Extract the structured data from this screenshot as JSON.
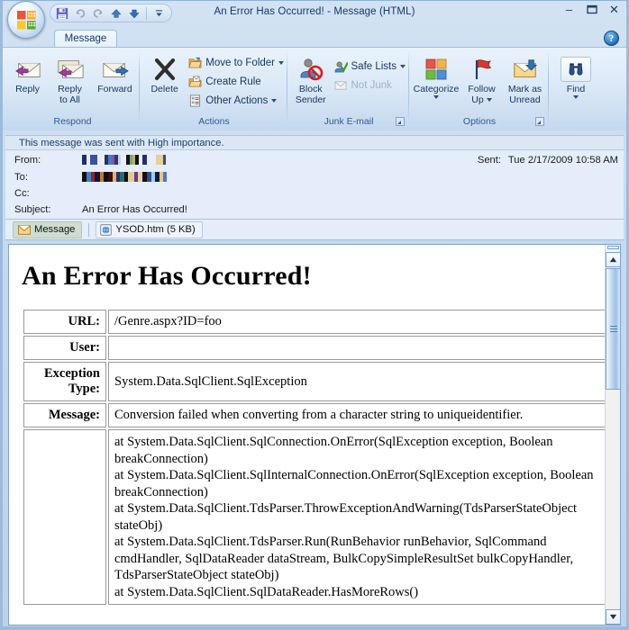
{
  "window": {
    "title": "An Error Has Occurred!  - Message (HTML)",
    "office_button": "office-orb",
    "controls": {
      "minimize": "–",
      "maximize": "❑",
      "close": "✕"
    },
    "help": "?"
  },
  "quick_access": {
    "items": [
      {
        "name": "save-button",
        "glyph": "save-icon"
      },
      {
        "name": "undo-button",
        "glyph": "undo-icon"
      },
      {
        "name": "redo-button",
        "glyph": "redo-icon"
      },
      {
        "name": "previous-item-button",
        "glyph": "up-arrow-icon"
      },
      {
        "name": "next-item-button",
        "glyph": "down-arrow-icon"
      }
    ],
    "customize_label": "customize-qat-icon"
  },
  "tabs": [
    {
      "label": "Message",
      "active": true
    }
  ],
  "ribbon": {
    "groups": [
      {
        "id": "respond",
        "label": "Respond",
        "buttons": [
          {
            "label": "Reply",
            "icon": "reply-icon"
          },
          {
            "label": "Reply\nto All",
            "line1": "Reply",
            "line2": "to All",
            "icon": "reply-all-icon"
          },
          {
            "label": "Forward",
            "icon": "forward-icon"
          }
        ]
      },
      {
        "id": "actions",
        "label": "Actions",
        "big": [
          {
            "label": "Delete",
            "icon": "delete-x-icon"
          }
        ],
        "small": [
          {
            "label": "Move to Folder",
            "icon": "move-to-folder-icon",
            "dropdown": true
          },
          {
            "label": "Create Rule",
            "icon": "create-rule-icon",
            "dropdown": false
          },
          {
            "label": "Other Actions",
            "icon": "other-actions-icon",
            "dropdown": true
          }
        ]
      },
      {
        "id": "junk",
        "label": "Junk E-mail",
        "big": [
          {
            "line1": "Block",
            "line2": "Sender",
            "icon": "block-sender-icon"
          }
        ],
        "small": [
          {
            "label": "Safe Lists",
            "icon": "safe-lists-icon",
            "dropdown": true
          },
          {
            "label": "Not Junk",
            "icon": "not-junk-icon",
            "dropdown": false,
            "disabled": true
          }
        ],
        "has_launcher": true
      },
      {
        "id": "options",
        "label": "Options",
        "buttons": [
          {
            "label": "Categorize",
            "icon": "categorize-icon",
            "dropdown": true
          },
          {
            "line1": "Follow",
            "line2": "Up",
            "icon": "follow-up-flag-icon",
            "dropdown": true
          },
          {
            "line1": "Mark as",
            "line2": "Unread",
            "icon": "mark-unread-icon",
            "dropdown": false
          }
        ],
        "has_launcher": true
      },
      {
        "id": "find",
        "label": "",
        "buttons": [
          {
            "label": "Find",
            "icon": "binoculars-icon",
            "dropdown": true
          }
        ]
      }
    ]
  },
  "infobar": {
    "text": "This message was sent with High importance."
  },
  "headers": {
    "from_label": "From:",
    "to_label": "To:",
    "cc_label": "Cc:",
    "subject_label": "Subject:",
    "sent_label": "Sent:",
    "sent_value": "Tue 2/17/2009 10:58 AM",
    "from_value": "",
    "to_value": "",
    "cc_value": "",
    "subject_value": "An Error Has Occurred!",
    "from_redacted_blocks": [
      {
        "w": 5,
        "c": "#1a2f6e"
      },
      {
        "w": 4,
        "c": "#e8eefb"
      },
      {
        "w": 8,
        "c": "#3b4fa3"
      },
      {
        "w": 8,
        "c": "#e8eefb"
      },
      {
        "w": 4,
        "c": "#2a2f5e"
      },
      {
        "w": 4,
        "c": "#4a78c8"
      },
      {
        "w": 3,
        "c": "#7b5aa8"
      },
      {
        "w": 4,
        "c": "#2f3670"
      },
      {
        "w": 3,
        "c": "#c6d2e8"
      },
      {
        "w": 6,
        "c": "#e8eefb"
      },
      {
        "w": 4,
        "c": "#141414"
      },
      {
        "w": 3,
        "c": "#7aa86a"
      },
      {
        "w": 3,
        "c": "#b9b07a"
      },
      {
        "w": 4,
        "c": "#101010"
      },
      {
        "w": 4,
        "c": "#e8eefb"
      },
      {
        "w": 5,
        "c": "#24306b"
      },
      {
        "w": 10,
        "c": "#e8eefb"
      },
      {
        "w": 8,
        "c": "#e6cf9a"
      },
      {
        "w": 3,
        "c": "#3a4890"
      }
    ],
    "to_redacted_blocks": [
      {
        "w": 5,
        "c": "#101010"
      },
      {
        "w": 5,
        "c": "#4a78c8"
      },
      {
        "w": 4,
        "c": "#8a2a2a"
      },
      {
        "w": 6,
        "c": "#14143c"
      },
      {
        "w": 4,
        "c": "#b98030"
      },
      {
        "w": 5,
        "c": "#101010"
      },
      {
        "w": 5,
        "c": "#3b1010"
      },
      {
        "w": 4,
        "c": "#e6b06a"
      },
      {
        "w": 4,
        "c": "#2a2f6e"
      },
      {
        "w": 5,
        "c": "#2f6a6a"
      },
      {
        "w": 4,
        "c": "#101010"
      },
      {
        "w": 7,
        "c": "#e0cc96"
      },
      {
        "w": 4,
        "c": "#6a3a8a"
      },
      {
        "w": 5,
        "c": "#e6d2a0"
      },
      {
        "w": 5,
        "c": "#101010"
      },
      {
        "w": 5,
        "c": "#3a4890"
      },
      {
        "w": 4,
        "c": "#8ad8e8"
      },
      {
        "w": 5,
        "c": "#14143c"
      },
      {
        "w": 4,
        "c": "#e6c48a"
      },
      {
        "w": 4,
        "c": "#4a78c8"
      }
    ]
  },
  "attachment_bar": {
    "message_tab": "Message",
    "message_icon": "envelope-icon",
    "attachment_name": "YSOD.htm (5 KB)",
    "attachment_icon": "html-file-icon"
  },
  "body": {
    "title": "An Error Has Occurred!",
    "rows": [
      {
        "key": "URL:",
        "value": "/Genre.aspx?ID=foo"
      },
      {
        "key": "User:",
        "value": ""
      },
      {
        "key": "Exception Type:",
        "value": "System.Data.SqlClient.SqlException"
      },
      {
        "key": "Message:",
        "value": "Conversion failed when converting from a character string to uniqueidentifier."
      },
      {
        "key": "",
        "value": "at System.Data.SqlClient.SqlConnection.OnError(SqlException exception, Boolean breakConnection)\nat System.Data.SqlClient.SqlInternalConnection.OnError(SqlException exception, Boolean breakConnection)\nat System.Data.SqlClient.TdsParser.ThrowExceptionAndWarning(TdsParserStateObject stateObj)\nat System.Data.SqlClient.TdsParser.Run(RunBehavior runBehavior, SqlCommand cmdHandler, SqlDataReader dataStream, BulkCopySimpleResultSet bulkCopyHandler, TdsParserStateObject stateObj)\nat System.Data.SqlClient.SqlDataReader.HasMoreRows()"
      }
    ]
  },
  "scrollbar": {
    "orientation": "vertical",
    "up_arrow": "▲",
    "down_arrow": "▼"
  },
  "colors": {
    "chrome": "#c6d9ee",
    "ribbon_top": "#e9f2fb",
    "accent_text": "#13375f",
    "group_label": "#2b5c93",
    "header_bg": "#e4edf9",
    "infobar_bg": "#dbe7f5",
    "body_bg": "#ffffff"
  }
}
